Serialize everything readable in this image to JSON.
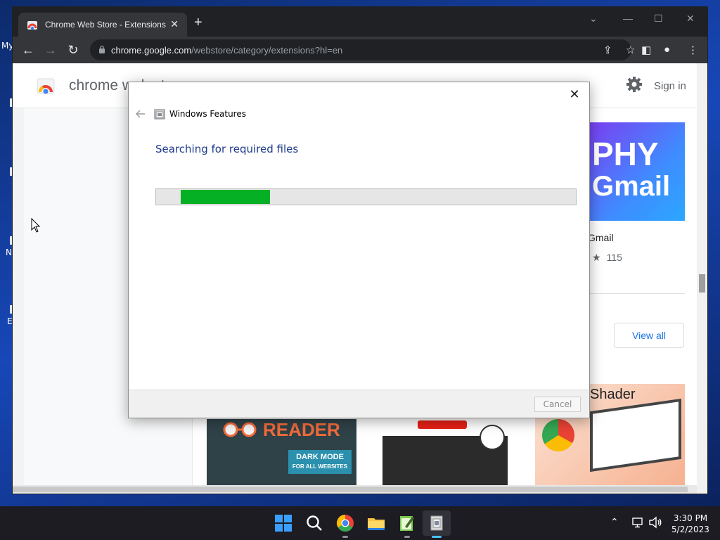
{
  "desktop": {
    "edge_texts": [
      "My",
      "N",
      "E"
    ]
  },
  "browser": {
    "tab": {
      "title": "Chrome Web Store - Extensions"
    },
    "address": {
      "host": "chrome.google.com",
      "path": "/webstore/category/extensions?hl=en"
    }
  },
  "webstore": {
    "brand": "chrome web store",
    "sign_in": "Sign in",
    "promo_lines": [
      "PHY",
      "Gmail"
    ],
    "card_name": "Gmail",
    "card_rating_count": "115",
    "view_all": "View all",
    "reader_big": "READER",
    "reader_badge_1": "DARK MODE",
    "reader_badge_2": "FOR ALL WEBSITES",
    "shader_text": "Shader"
  },
  "dialog": {
    "title": "Windows Features",
    "heading": "Searching for required files",
    "progress": {
      "start": 0.058,
      "end": 0.27
    },
    "cancel": "Cancel"
  },
  "taskbar": {
    "time": "3:30 PM",
    "date": "5/2/2023"
  },
  "colors": {
    "progress_fill": "#06b025",
    "heading_blue": "#1e3a8a",
    "link_blue": "#1a73e8"
  }
}
